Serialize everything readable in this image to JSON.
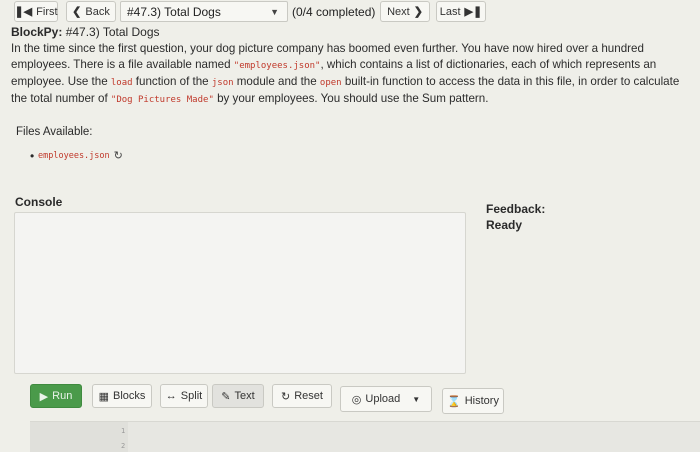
{
  "nav": {
    "first_label": "First",
    "back_label": "Back",
    "problem_select": "#47.3) Total Dogs",
    "progress": "(0/4 completed)",
    "next_label": "Next",
    "last_label": "Last"
  },
  "problem": {
    "title_prefix": "BlockPy:",
    "title_rest": " #47.3) Total Dogs",
    "desc": {
      "p1": "In the time since the first question, your dog picture company has boomed even further. You have now hired over a hundred employees. There is a file available named ",
      "code1": "\"employees.json\"",
      "p2": ", which contains a list of dictionaries, each of which represents an employee. Use the ",
      "code2": "load",
      "p3": " function of the ",
      "code3": "json",
      "p4": " module and the ",
      "code4": "open",
      "p5": " built-in function to access the data in this file, in order to calculate the total number of ",
      "code5": "\"Dog Pictures Made\"",
      "p6": " by your employees. You should use the Sum pattern."
    }
  },
  "files": {
    "label": "Files Available:",
    "items": [
      {
        "name": "employees.json"
      }
    ]
  },
  "console": {
    "label": "Console"
  },
  "feedback": {
    "title": "Feedback:",
    "status": "Ready"
  },
  "toolbar": {
    "run": "Run",
    "blocks": "Blocks",
    "split": "Split",
    "text": "Text",
    "reset": "Reset",
    "upload": "Upload",
    "history": "History"
  },
  "editor": {
    "lines": [
      "1",
      "2"
    ]
  },
  "icons": {
    "first": "skip-first-icon",
    "back": "chevron-left-icon",
    "next": "chevron-right-icon",
    "last": "skip-last-icon",
    "run": "play-icon",
    "blocks": "grid-icon",
    "split": "split-arrows-icon",
    "text": "pencil-icon",
    "reset": "refresh-icon",
    "upload": "upload-icon",
    "history": "hourglass-icon",
    "external": "external-link-icon"
  },
  "colors": {
    "run_button": "#4a9a4a",
    "code_text": "#c0392b"
  }
}
